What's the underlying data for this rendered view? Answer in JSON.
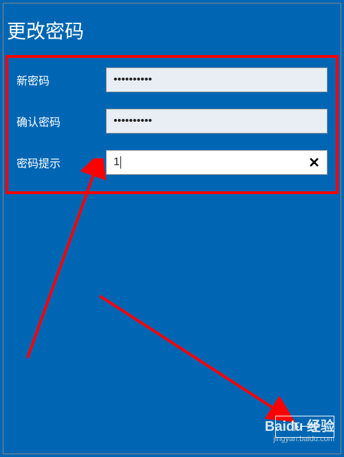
{
  "page": {
    "title": "更改密码"
  },
  "form": {
    "new_password": {
      "label": "新密码",
      "value": "••••••••••"
    },
    "confirm_password": {
      "label": "确认密码",
      "value": "••••••••••"
    },
    "password_hint": {
      "label": "密码提示",
      "value": "1",
      "clear_icon": "✕"
    }
  },
  "buttons": {
    "next": "下一步"
  },
  "watermark": {
    "logo": "Baidu 经验",
    "url": "jingyan.baidu.com"
  }
}
